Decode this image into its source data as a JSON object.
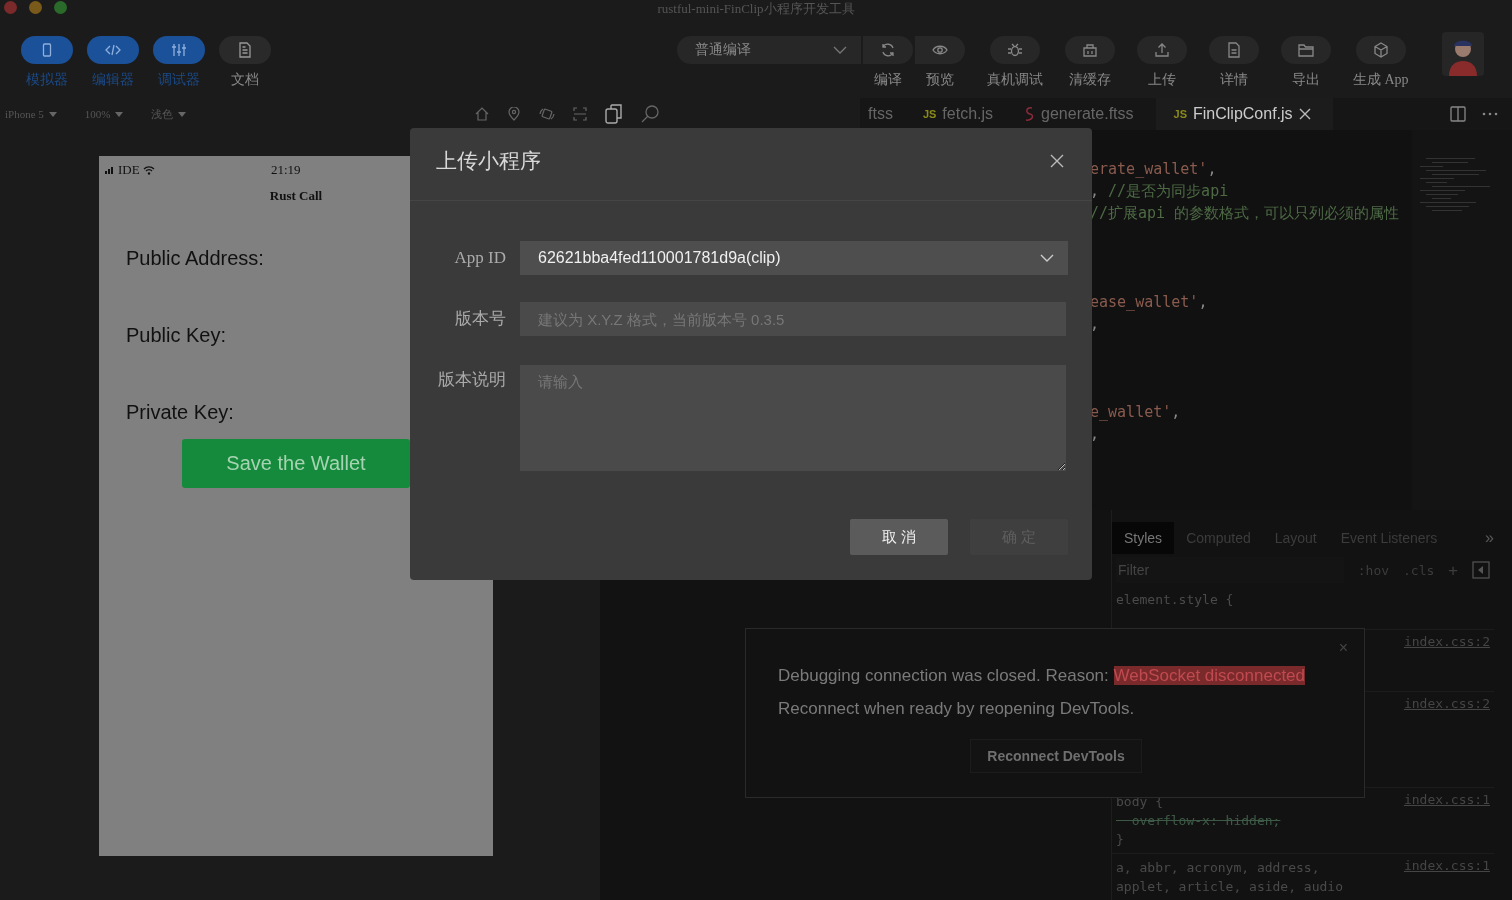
{
  "window": {
    "title": "rustful-mini-FinClip小程序开发工具"
  },
  "mode_buttons": [
    {
      "label": "模拟器",
      "selected": true
    },
    {
      "label": "编辑器",
      "selected": true
    },
    {
      "label": "调试器",
      "selected": true
    },
    {
      "label": "文档",
      "selected": false
    }
  ],
  "compile_select": {
    "value": "普通编译"
  },
  "tool_buttons": [
    {
      "label": "编译"
    },
    {
      "label": "预览"
    },
    {
      "label": "真机调试"
    },
    {
      "label": "清缓存"
    },
    {
      "label": "上传"
    },
    {
      "label": "详情"
    },
    {
      "label": "导出"
    },
    {
      "label": "生成 App"
    }
  ],
  "sim_bar": {
    "device": "iPhone 5",
    "zoom": "100%",
    "theme": "浅色"
  },
  "editor_tabs": [
    {
      "kind": "plain",
      "label": "ftss",
      "selected": false
    },
    {
      "kind": "js",
      "badge": "JS",
      "label": "fetch.js",
      "selected": false
    },
    {
      "kind": "style",
      "label": "generate.ftss",
      "selected": false
    },
    {
      "kind": "js",
      "badge": "JS",
      "label": "FinClipConf.js",
      "selected": true
    }
  ],
  "code_blocks": [
    [
      [
        {
          "kind": "string",
          "text": "erate_wallet'"
        },
        {
          "kind": "plain",
          "text": ","
        }
      ],
      [
        {
          "kind": "plain",
          "text": ", "
        },
        {
          "kind": "comment",
          "text": "//是否为同步api"
        }
      ],
      [
        {
          "kind": "comment",
          "text": "//扩展api 的参数格式，可以只列必须的属性"
        }
      ]
    ],
    [
      [
        {
          "kind": "string",
          "text": "ease_wallet'"
        },
        {
          "kind": "plain",
          "text": ","
        }
      ],
      [
        {
          "kind": "plain",
          "text": ","
        }
      ]
    ],
    [
      [
        {
          "kind": "string",
          "text": "e_wallet'"
        },
        {
          "kind": "plain",
          "text": ","
        }
      ],
      [
        {
          "kind": "plain",
          "text": ","
        }
      ]
    ]
  ],
  "phone": {
    "carrier": "IDE",
    "time": "21:19",
    "title": "Rust Call",
    "fields": [
      "Public Address:",
      "Public Key:",
      "Private Key:"
    ],
    "button": "Save the Wallet"
  },
  "devtools": {
    "tabs": [
      {
        "label": "Styles",
        "selected": true
      },
      {
        "label": "Computed",
        "selected": false
      },
      {
        "label": "Layout",
        "selected": false
      },
      {
        "label": "Event Listeners",
        "selected": false
      }
    ],
    "more": "»",
    "filter_placeholder": "Filter",
    "hov": ":hov",
    "cls": ".cls",
    "add": "+",
    "rules": [
      {
        "lines": [
          {
            "text": "element.style {",
            "struck": false
          }
        ]
      },
      {
        "source": "index.css:2"
      },
      {
        "source": "index.css:2"
      },
      {
        "source": "index.css:1",
        "lines": [
          {
            "text": "body {",
            "struck": false
          },
          {
            "text": "  overflow-x: hidden;",
            "struck": true
          },
          {
            "text": "}",
            "struck": false
          }
        ]
      },
      {
        "source": "index.css:1",
        "lines": [
          {
            "text": "a, abbr, acronym, address,",
            "struck": false
          },
          {
            "text": "applet, article, aside, audio",
            "struck": false
          }
        ]
      }
    ]
  },
  "notification": {
    "message": "Debugging connection was closed. Reason: ",
    "reason": "WebSocket disconnected",
    "hint": "Reconnect when ready by reopening DevTools.",
    "button": "Reconnect DevTools",
    "close": "×"
  },
  "dialog": {
    "title": "上传小程序",
    "fields": [
      {
        "kind": "select",
        "label": "App ID",
        "value": "62621bba4fed110001781d9a(clip)"
      },
      {
        "kind": "input",
        "label": "版本号",
        "placeholder": "建议为 X.Y.Z 格式，当前版本号 0.3.5"
      },
      {
        "kind": "textarea",
        "label": "版本说明",
        "placeholder": "请输入"
      }
    ],
    "buttons": [
      {
        "label": "取 消",
        "disabled": false
      },
      {
        "label": "确 定",
        "disabled": true
      }
    ]
  }
}
